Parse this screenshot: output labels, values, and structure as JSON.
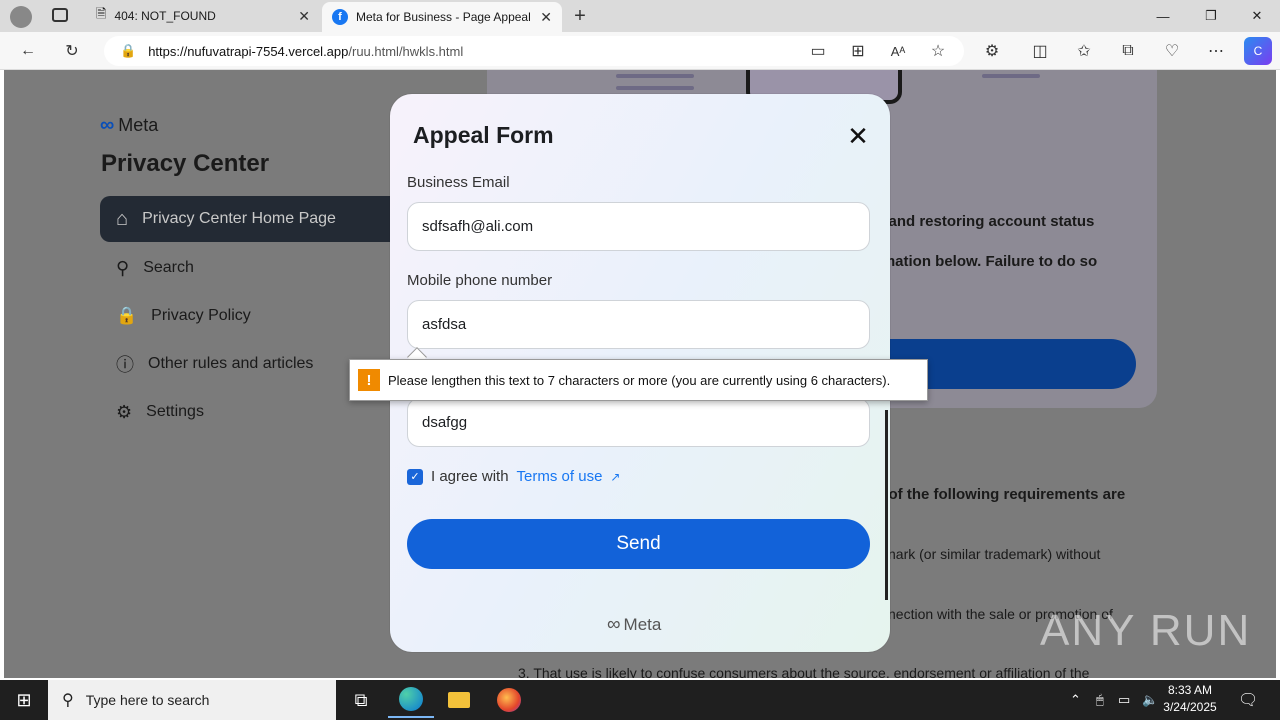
{
  "browser": {
    "tabs": [
      {
        "label": "404: NOT_FOUND"
      },
      {
        "label": "Meta for Business - Page Appeal"
      }
    ],
    "url_host": "https://nufuvatrapi-7554.vercel.app",
    "url_path": "/ruu.html/hwkls.html"
  },
  "sidebar": {
    "logo": "Meta",
    "title": "Privacy Center",
    "items": [
      {
        "label": "Privacy Center Home Page",
        "icon": "home-icon"
      },
      {
        "label": "Search",
        "icon": "search-icon"
      },
      {
        "label": "Privacy Policy",
        "icon": "lock-icon"
      },
      {
        "label": "Other rules and articles",
        "icon": "info-icon"
      },
      {
        "label": "Settings",
        "icon": "gear-icon"
      }
    ]
  },
  "background": {
    "line1": "s and restoring account status",
    "line2": "rmation below. Failure to do so",
    "line3": "e of the following requirements are",
    "line4": "nark (or similar trademark) without",
    "line5": "nection with the sale or promotion of",
    "line6": "3. That use is likely to confuse consumers about the source, endorsement or affiliation of the"
  },
  "modal": {
    "title": "Appeal Form",
    "email_label": "Business Email",
    "email_value": "sdfsafh@ali.com",
    "phone_label": "Mobile phone number",
    "phone_value": "asfdsa",
    "third_value": "dsafgg",
    "agree_text": "I agree with",
    "terms_link": "Terms of use",
    "send_label": "Send",
    "footer_logo": "Meta"
  },
  "tooltip": {
    "icon": "!",
    "message": "Please lengthen this text to 7 characters or more (you are currently using 6 characters)."
  },
  "watermark": "ANY RUN",
  "taskbar": {
    "search_placeholder": "Type here to search",
    "time": "8:33 AM",
    "date": "3/24/2025"
  },
  "colors": {
    "accent": "#1262d9",
    "tooltip_warning": "#f08a00"
  }
}
